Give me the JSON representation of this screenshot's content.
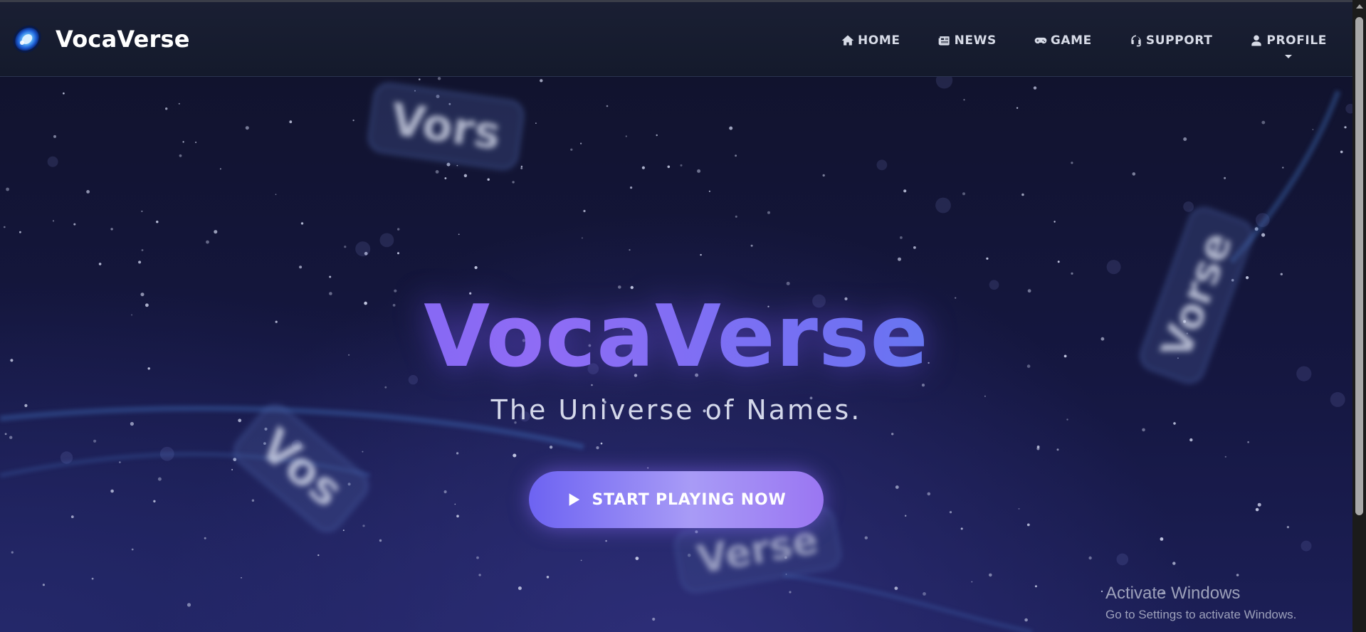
{
  "brand": {
    "name": "VocaVerse",
    "logo_icon": "planet-logo-icon"
  },
  "nav": {
    "items": [
      {
        "label": "HOME",
        "icon": "home-icon"
      },
      {
        "label": "NEWS",
        "icon": "newspaper-icon"
      },
      {
        "label": "GAME",
        "icon": "gamepad-icon"
      },
      {
        "label": "SUPPORT",
        "icon": "headset-icon"
      },
      {
        "label": "PROFILE",
        "icon": "user-icon",
        "has_dropdown": true
      }
    ]
  },
  "hero": {
    "title": "VocaVerse",
    "tagline": "The Universe of Names.",
    "cta_label": "START PLAYING NOW",
    "cta_icon": "play-icon",
    "floating_tags": [
      "Vors",
      "Vorse",
      "Vos",
      "Verse"
    ]
  },
  "os_notice": {
    "title": "Activate Windows",
    "subtitle": "Go to Settings to activate Windows."
  },
  "colors": {
    "nav_bg": "#171c2f",
    "hero_bg": "#131538",
    "title_gradient_start": "#6a5cf0",
    "title_gradient_end": "#2ea6e6",
    "cta_gradient_start": "#6d63f2",
    "cta_gradient_end": "#9a76f2"
  }
}
